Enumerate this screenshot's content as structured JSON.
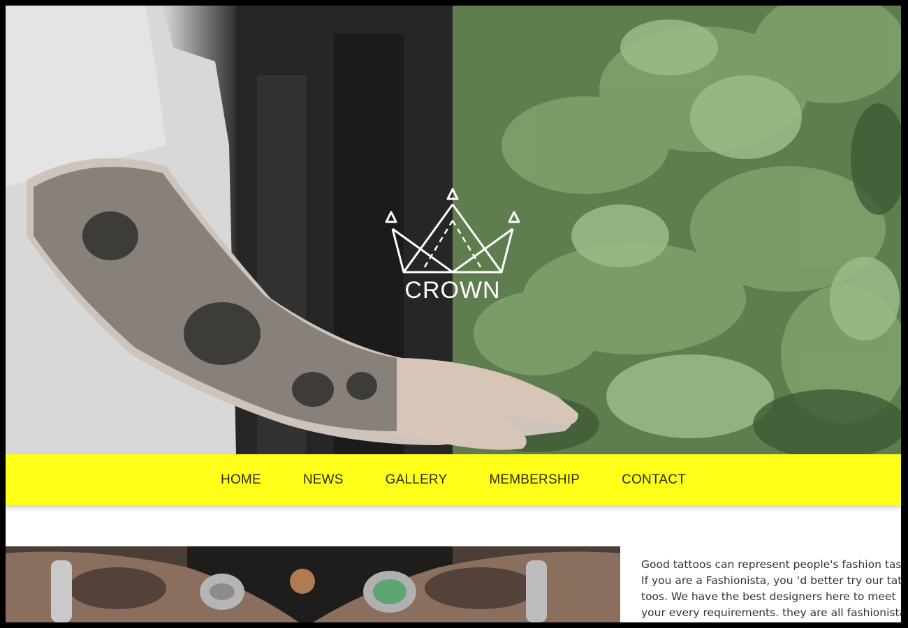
{
  "brand": {
    "name": "CROWN"
  },
  "nav": {
    "items": [
      {
        "label": "HOME"
      },
      {
        "label": "NEWS"
      },
      {
        "label": "GALLERY"
      },
      {
        "label": "MEMBERSHIP"
      },
      {
        "label": "CONTACT"
      }
    ]
  },
  "content": {
    "lines": [
      "Good tattoos can represent people's fashion tas",
      "If you are a Fashionista, you ‘d better try our tat",
      "toos. We have the best designers here to meet",
      "your every requirements. they are all fashionista"
    ]
  },
  "colors": {
    "nav_bg": "#ffff1a",
    "nav_text": "#2b2b00",
    "logo": "#ffffff"
  }
}
